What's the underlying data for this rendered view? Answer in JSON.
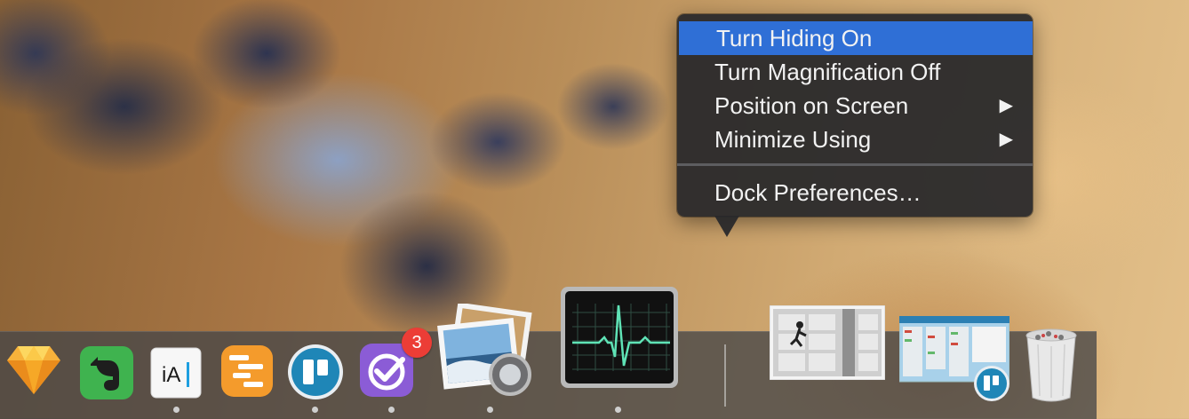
{
  "context_menu": {
    "items": [
      {
        "label": "Turn Hiding On",
        "highlighted": true,
        "submenu": false
      },
      {
        "label": "Turn Magnification Off",
        "highlighted": false,
        "submenu": false
      },
      {
        "label": "Position on Screen",
        "highlighted": false,
        "submenu": true
      },
      {
        "label": "Minimize Using",
        "highlighted": false,
        "submenu": true
      },
      {
        "label": "Dock Preferences…",
        "highlighted": false,
        "submenu": false
      }
    ],
    "submenu_arrow": "▶",
    "highlight_color": "#2f6fd6"
  },
  "dock": {
    "apps": [
      {
        "icon": "sketch-icon",
        "running": true
      },
      {
        "icon": "evernote-icon",
        "running": false
      },
      {
        "icon": "ia-writer-icon",
        "running": false
      },
      {
        "icon": "omniplan-icon",
        "running": true
      },
      {
        "icon": "trello-icon",
        "running": true
      },
      {
        "icon": "omnifocus-icon",
        "running": true,
        "badge": "3"
      },
      {
        "icon": "preview-icon",
        "running": true
      },
      {
        "icon": "activity-monitor-icon",
        "running": true
      }
    ],
    "right_items": [
      {
        "icon": "minimized-window-image"
      },
      {
        "icon": "minimized-window-trello"
      },
      {
        "icon": "trash-icon"
      }
    ],
    "badge_color": "#ec3d36"
  }
}
